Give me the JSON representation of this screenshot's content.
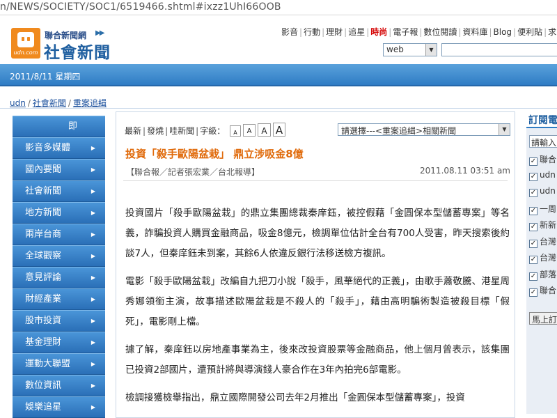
{
  "browser": {
    "url": "n/NEWS/SOCIETY/SOC1/6519466.shtml#ixzz1UhI66OOB"
  },
  "header": {
    "logo_sub": "udn.com",
    "brand_top": "聯合新聞網",
    "brand_main": "社會新聞",
    "nav": [
      {
        "label": "影音",
        "hot": false
      },
      {
        "label": "行動",
        "hot": false
      },
      {
        "label": "理財",
        "hot": false
      },
      {
        "label": "追星",
        "hot": false
      },
      {
        "label": "時尚",
        "hot": true
      },
      {
        "label": "電子報",
        "hot": false
      },
      {
        "label": "數位閱讀",
        "hot": false
      },
      {
        "label": "資料庫",
        "hot": false
      },
      {
        "label": "Blog",
        "hot": false
      },
      {
        "label": "便利貼",
        "hot": false
      },
      {
        "label": "求",
        "hot": false
      }
    ],
    "search_scope": "web",
    "search_value": ""
  },
  "datebar": {
    "date": "2011/8/11 星期四"
  },
  "breadcrumb": [
    "udn",
    "社會新聞",
    "重案追緝"
  ],
  "leftnav": [
    "即",
    "影音多媒體",
    "國內要聞",
    "社會新聞",
    "地方新聞",
    "兩岸台商",
    "全球觀察",
    "意見評論",
    "財經產業",
    "股市投資",
    "基金理財",
    "運動大聯盟",
    "數位資訊",
    "娛樂追星"
  ],
  "toolbar": {
    "links": [
      "最新",
      "發燒",
      "哇新聞"
    ],
    "font_label": "字級：",
    "font_sizes": [
      "A",
      "A",
      "A",
      "A"
    ],
    "related_select": "請選擇---<重案追緝>相關新聞"
  },
  "article": {
    "headline": "投資「殺手歐陽盆栽」 鼎立涉吸金8億",
    "byline": "【聯合報／記者張宏業／台北報導】",
    "time": "2011.08.11 03:51 am",
    "paragraphs": [
      "投資國片「殺手歐陽盆栽」的鼎立集團總裁秦庠鈺，被控假藉「金圓保本型儲蓄專案」等名義，詐騙投資人購買金融商品，吸金8億元，檢調單位估計全台有700人受害，昨天搜索後約談7人，但秦庠鈺未到案，其餘6人依違反銀行法移送檢方複訊。",
      "電影「殺手歐陽盆栽」改編自九把刀小說「殺手，風華絕代的正義」，由歌手蕭敬騰、港星周秀娜領銜主演，故事描述歐陽盆栽是不殺人的「殺手」，藉由高明騙術製造被殺目標「假死」，電影剛上檔。",
      "據了解，秦庠鈺以房地產事業為主，後來改投資股票等金融商品，他上個月曾表示，該集團已投資2部國片，還預計將與導演錢人豪合作在3年內拍完6部電影。",
      "檢調接獲檢舉指出，鼎立國際開發公司去年2月推出「金圓保本型儲蓄專案」，投資"
    ]
  },
  "right": {
    "title": "訂閱電",
    "input_value": "請輸入",
    "checkboxes": [
      "聯合",
      "udn",
      "udn",
      "一周",
      "新新",
      "台灣",
      "台灣",
      "部落",
      "聯合"
    ],
    "button": "馬上訂"
  }
}
